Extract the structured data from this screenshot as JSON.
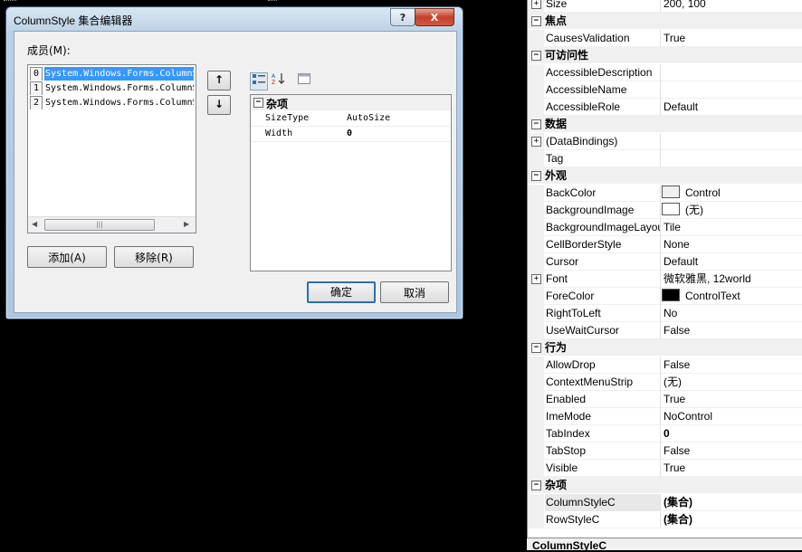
{
  "dialog": {
    "title": "ColumnStyle 集合编辑器",
    "help_glyph": "?",
    "close_glyph": "X",
    "members_label": "成员(M):",
    "members": [
      {
        "index": "0",
        "text": "System.Windows.Forms.ColumnS"
      },
      {
        "index": "1",
        "text": "System.Windows.Forms.ColumnS"
      },
      {
        "index": "2",
        "text": "System.Windows.Forms.ColumnS"
      }
    ],
    "up_glyph": "↑",
    "down_glyph": "↓",
    "add_label": "添加(A)",
    "remove_label": "移除(R)",
    "ok_label": "确定",
    "cancel_label": "取消",
    "scroll_thumb_glyph": "|||",
    "grid": {
      "category": "杂项",
      "rows": [
        {
          "name": "SizeType",
          "value": "AutoSize"
        },
        {
          "name": "Width",
          "value": "0"
        }
      ]
    }
  },
  "panel": {
    "rows": [
      {
        "kind": "prop",
        "expander": "+",
        "name": "Size",
        "value": "200, 100"
      },
      {
        "kind": "cat",
        "label": "焦点"
      },
      {
        "kind": "prop",
        "name": "CausesValidation",
        "value": "True"
      },
      {
        "kind": "cat",
        "label": "可访问性"
      },
      {
        "kind": "prop",
        "name": "AccessibleDescription",
        "value": ""
      },
      {
        "kind": "prop",
        "name": "AccessibleName",
        "value": ""
      },
      {
        "kind": "prop",
        "name": "AccessibleRole",
        "value": "Default"
      },
      {
        "kind": "cat",
        "label": "数据"
      },
      {
        "kind": "prop",
        "expander": "+",
        "name": "(DataBindings)",
        "value": ""
      },
      {
        "kind": "prop",
        "name": "Tag",
        "value": ""
      },
      {
        "kind": "cat",
        "label": "外观"
      },
      {
        "kind": "prop",
        "name": "BackColor",
        "value": "Control",
        "swatch": "#f0f0f0"
      },
      {
        "kind": "prop",
        "name": "BackgroundImage",
        "value": "(无)",
        "swatch": "#ffffff"
      },
      {
        "kind": "prop",
        "name": "BackgroundImageLayout",
        "value": "Tile"
      },
      {
        "kind": "prop",
        "name": "CellBorderStyle",
        "value": "None"
      },
      {
        "kind": "prop",
        "name": "Cursor",
        "value": "Default"
      },
      {
        "kind": "prop",
        "expander": "+",
        "name": "Font",
        "value": "微软雅黑, 12world"
      },
      {
        "kind": "prop",
        "name": "ForeColor",
        "value": "ControlText",
        "swatch": "#000000"
      },
      {
        "kind": "prop",
        "name": "RightToLeft",
        "value": "No"
      },
      {
        "kind": "prop",
        "name": "UseWaitCursor",
        "value": "False"
      },
      {
        "kind": "cat",
        "label": "行为"
      },
      {
        "kind": "prop",
        "name": "AllowDrop",
        "value": "False"
      },
      {
        "kind": "prop",
        "name": "ContextMenuStrip",
        "value": "(无)"
      },
      {
        "kind": "prop",
        "name": "Enabled",
        "value": "True"
      },
      {
        "kind": "prop",
        "name": "ImeMode",
        "value": "NoControl"
      },
      {
        "kind": "prop",
        "name": "TabIndex",
        "value": "0",
        "bold": true
      },
      {
        "kind": "prop",
        "name": "TabStop",
        "value": "False"
      },
      {
        "kind": "prop",
        "name": "Visible",
        "value": "True"
      },
      {
        "kind": "cat",
        "label": "杂项"
      },
      {
        "kind": "prop",
        "name": "ColumnStyleC",
        "value": "(集合)",
        "bold": true,
        "highlight": true
      },
      {
        "kind": "prop",
        "name": "RowStyleC",
        "value": "(集合)",
        "bold": true
      }
    ],
    "footer": "ColumnStyleC"
  }
}
